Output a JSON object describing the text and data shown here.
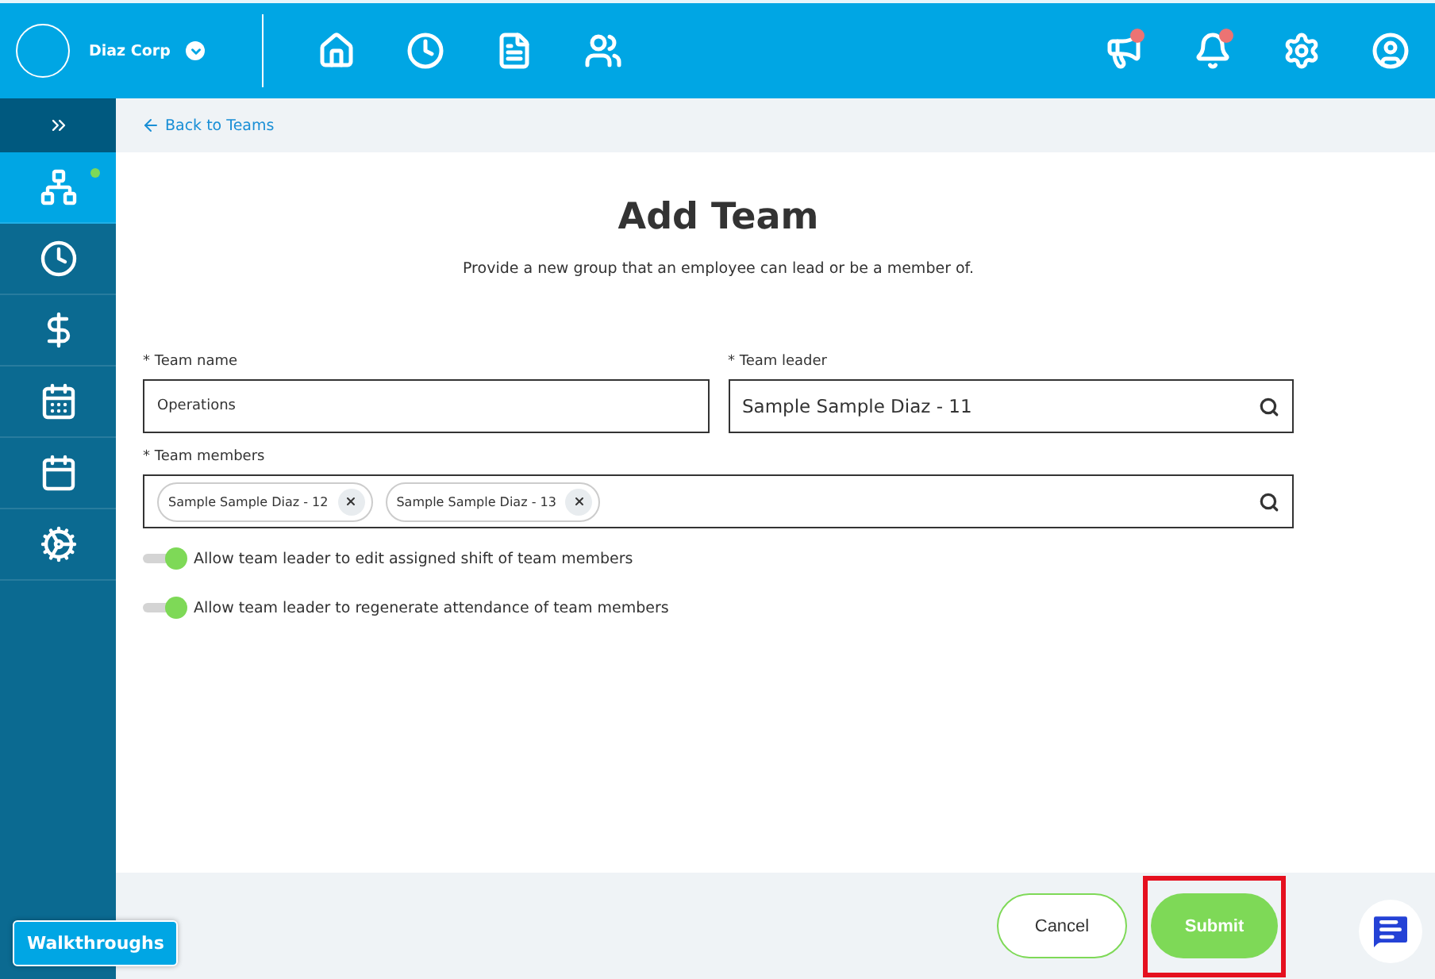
{
  "header": {
    "company": "Diaz Corp",
    "nav": [
      {
        "kind": "home",
        "selected": false
      },
      {
        "kind": "clock",
        "selected": false
      },
      {
        "kind": "document",
        "selected": false
      },
      {
        "kind": "people",
        "selected": false
      }
    ],
    "actions": [
      {
        "kind": "megaphone",
        "alert": true
      },
      {
        "kind": "bell",
        "alert": true
      },
      {
        "kind": "settings",
        "alert": false
      },
      {
        "kind": "user",
        "alert": false
      }
    ]
  },
  "sidebar": {
    "items": [
      {
        "kind": "org",
        "selected": true,
        "dot": true
      },
      {
        "kind": "clock",
        "selected": false,
        "dot": false
      },
      {
        "kind": "dollar",
        "selected": false,
        "dot": false
      },
      {
        "kind": "calendar-day",
        "selected": false,
        "dot": false
      },
      {
        "kind": "calendar",
        "selected": false,
        "dot": false
      },
      {
        "kind": "cogs",
        "selected": false,
        "dot": false
      }
    ]
  },
  "breadcrumb": "Back to Teams",
  "title": "Add Team",
  "subtitle": "Provide a new group that an employee can lead or be a member of.",
  "fields": {
    "team_name": {
      "label": "* Team name",
      "value": "Operations"
    },
    "team_leader": {
      "label": "* Team leader",
      "value": "Sample Sample Diaz - 11"
    },
    "team_members": {
      "label": "* Team members",
      "chips": [
        "Sample Sample Diaz - 12",
        "Sample Sample Diaz - 13"
      ]
    }
  },
  "toggles": [
    {
      "label": "Allow team leader to edit assigned shift of team members",
      "on": true
    },
    {
      "label": "Allow team leader to regenerate attendance of team members",
      "on": true
    }
  ],
  "buttons": {
    "cancel": "Cancel",
    "submit": "Submit"
  },
  "walkthroughs": "Walkthroughs"
}
